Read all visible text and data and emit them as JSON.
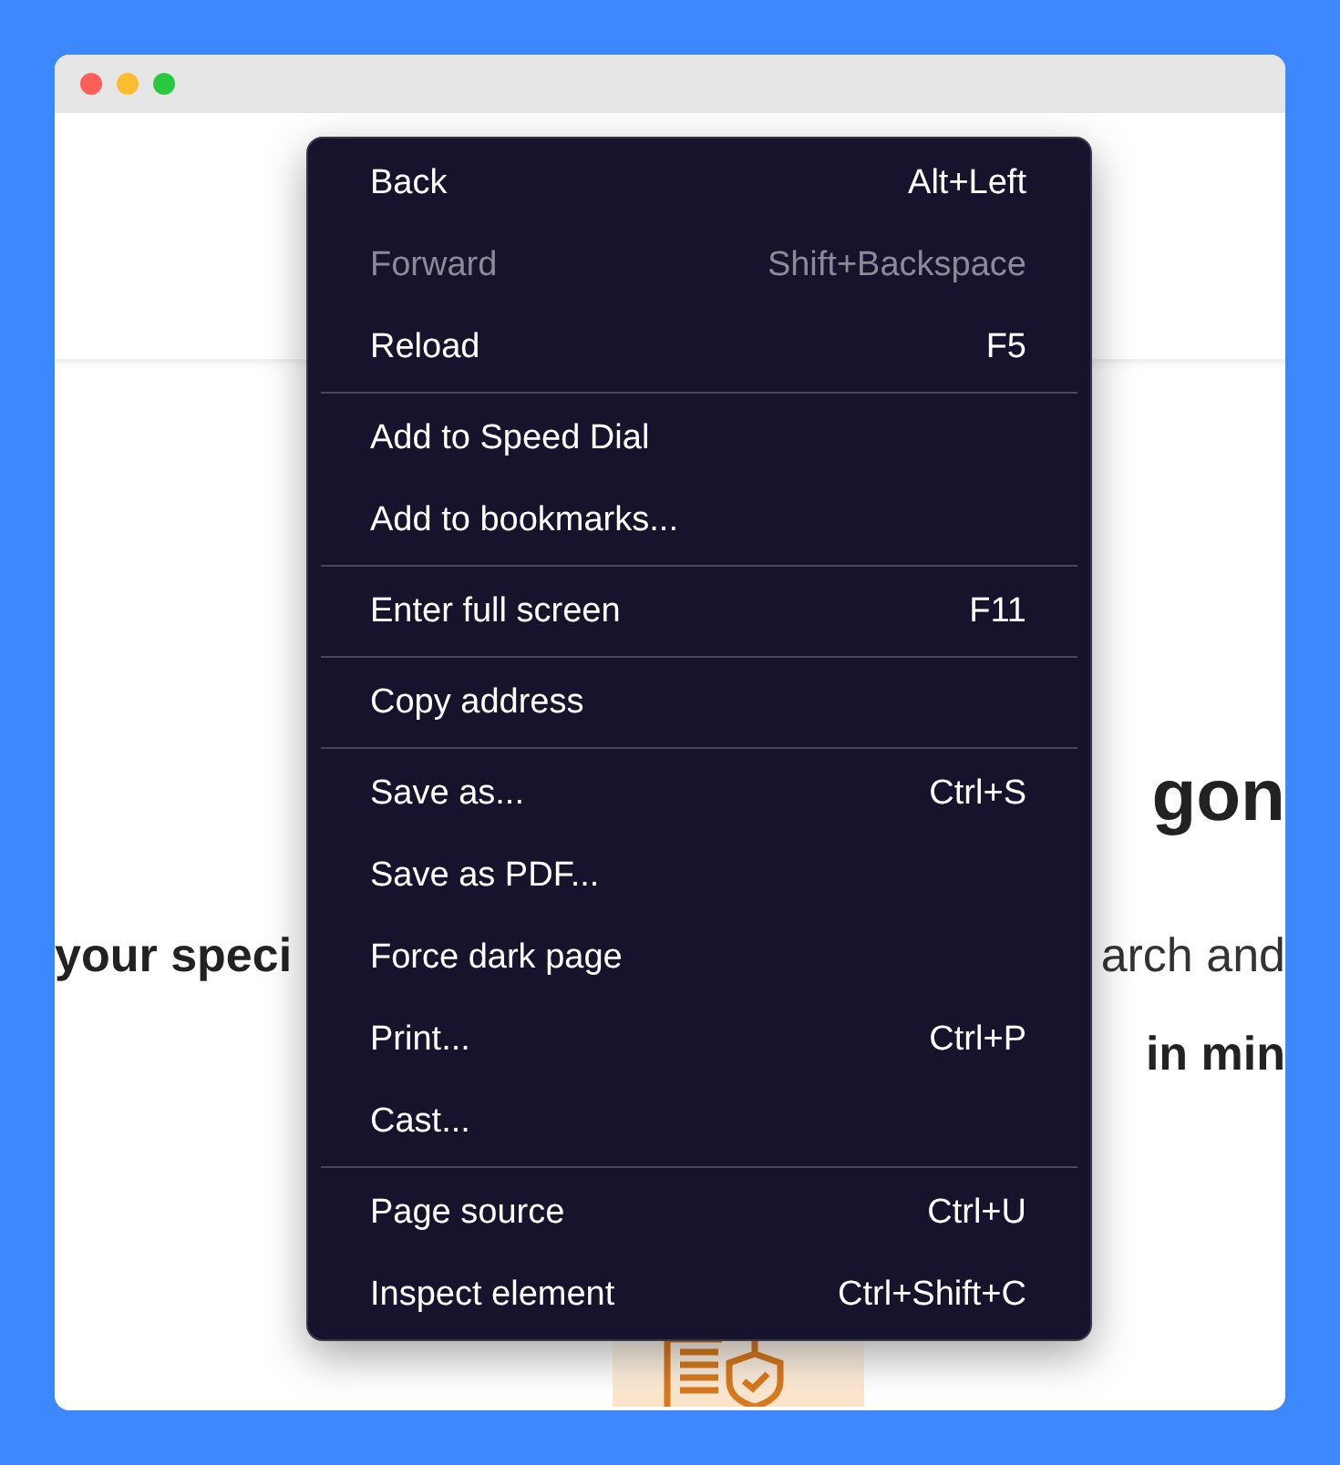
{
  "page": {
    "heading": "gon",
    "text_left": "your speci",
    "text_right": "arch and",
    "bold_line": "in min"
  },
  "context_menu": {
    "groups": [
      {
        "items": [
          {
            "label": "Back",
            "shortcut": "Alt+Left",
            "disabled": false
          },
          {
            "label": "Forward",
            "shortcut": "Shift+Backspace",
            "disabled": true
          },
          {
            "label": "Reload",
            "shortcut": "F5",
            "disabled": false
          }
        ]
      },
      {
        "items": [
          {
            "label": "Add to Speed Dial",
            "disabled": false
          },
          {
            "label": "Add to bookmarks...",
            "disabled": false
          }
        ]
      },
      {
        "items": [
          {
            "label": "Enter full screen",
            "shortcut": "F11",
            "disabled": false
          }
        ]
      },
      {
        "items": [
          {
            "label": "Copy address",
            "disabled": false
          }
        ]
      },
      {
        "items": [
          {
            "label": "Save as...",
            "shortcut": "Ctrl+S",
            "disabled": false
          },
          {
            "label": "Save as PDF...",
            "disabled": false
          },
          {
            "label": "Force dark page",
            "disabled": false
          },
          {
            "label": "Print...",
            "shortcut": "Ctrl+P",
            "disabled": false
          },
          {
            "label": "Cast...",
            "disabled": false
          }
        ]
      },
      {
        "items": [
          {
            "label": "Page source",
            "shortcut": "Ctrl+U",
            "disabled": false
          },
          {
            "label": "Inspect element",
            "shortcut": "Ctrl+Shift+C",
            "disabled": false
          }
        ]
      }
    ]
  }
}
